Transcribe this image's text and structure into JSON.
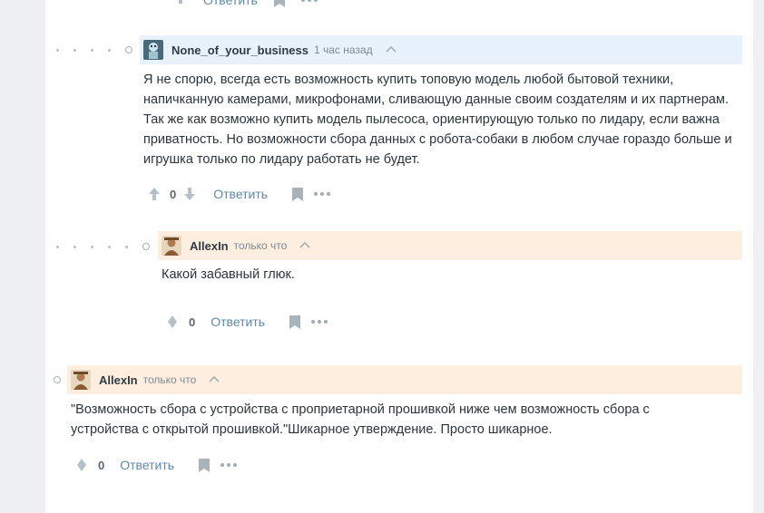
{
  "colors": {
    "page_bg": "#eef0f1",
    "content_bg": "#ffffff",
    "header_highlight_blue": "#e8f2fc",
    "header_highlight_new": "#fdeee0",
    "link": "#5e8aa8",
    "muted": "#7d8a93"
  },
  "top_partial": {
    "reply_label": "Ответить"
  },
  "comments": [
    {
      "author": "None_of_your_business",
      "time": "1 час назад",
      "avatar": "robot-avatar-icon",
      "text": "Я не спорю, всегда есть возможность купить топовую модель любой бытовой техники, напичканную камерами, микрофонами, сливающую данные своим создателям и их партнерам. Так же как возможно купить модель пылесоса, ориентирующую только по лидару, если важна приватность. Но возможности сбора данных с робота-собаки в любом случае гораздо больше и игрушка только по лидару работать не будет.",
      "votes": "0",
      "reply_label": "Ответить"
    },
    {
      "author": "AllexIn",
      "time": "только что",
      "avatar": "user-avatar-icon",
      "text": "Какой забавный глюк.",
      "votes": "0",
      "reply_label": "Ответить"
    },
    {
      "author": "AllexIn",
      "time": "только что",
      "avatar": "user-avatar-icon",
      "text": "\"Возможность сбора с устройства с проприетарной прошивкой ниже чем возможность сбора с устройства с открытой прошивкой.\"Шикарное утверждение. Просто шикарное.",
      "votes": "0",
      "reply_label": "Ответить"
    }
  ]
}
